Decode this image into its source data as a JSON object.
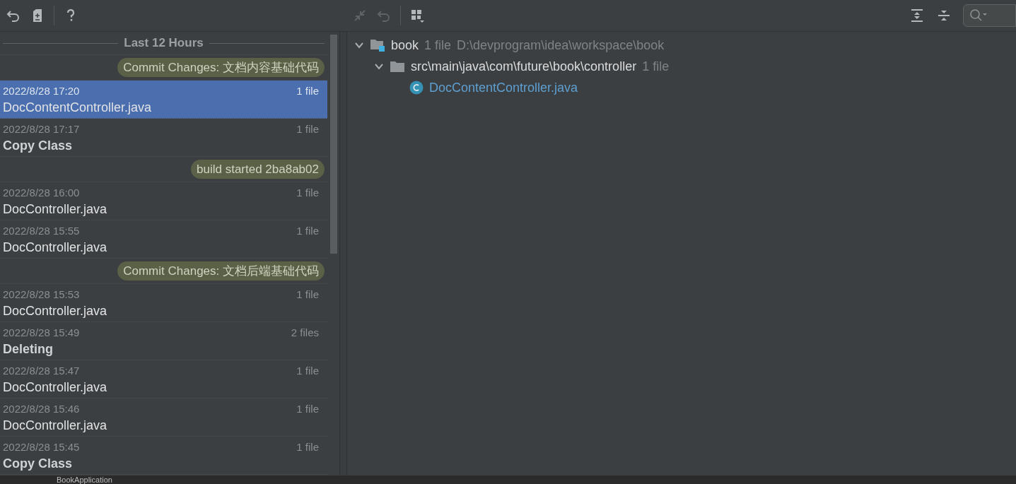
{
  "toolbar": {
    "left_tools": [
      {
        "kind": "undo",
        "disabled": false
      },
      {
        "kind": "diff",
        "disabled": false
      },
      {
        "kind": "help",
        "disabled": false
      }
    ],
    "middle_tools": [
      {
        "kind": "merge",
        "disabled": true
      },
      {
        "kind": "undo",
        "disabled": true
      },
      {
        "kind": "group",
        "disabled": false
      }
    ],
    "right_tools": [
      {
        "kind": "expand",
        "disabled": false
      },
      {
        "kind": "collapse",
        "disabled": false
      }
    ]
  },
  "history": [
    {
      "kind": "header",
      "text": "Last 12 Hours"
    },
    {
      "kind": "label",
      "text": "Commit Changes: 文档内容基础代码"
    },
    {
      "kind": "entry",
      "time": "2022/8/28 17:20",
      "files": "1 file",
      "title": "DocContentController.java",
      "bold": false,
      "selected": true
    },
    {
      "kind": "entry",
      "time": "2022/8/28 17:17",
      "files": "1 file",
      "title": "Copy Class",
      "bold": true,
      "selected": false
    },
    {
      "kind": "label",
      "text": "build started 2ba8ab02"
    },
    {
      "kind": "entry",
      "time": "2022/8/28 16:00",
      "files": "1 file",
      "title": "DocController.java",
      "bold": false,
      "selected": false
    },
    {
      "kind": "entry",
      "time": "2022/8/28 15:55",
      "files": "1 file",
      "title": "DocController.java",
      "bold": false,
      "selected": false
    },
    {
      "kind": "label",
      "text": "Commit Changes: 文档后端基础代码"
    },
    {
      "kind": "entry",
      "time": "2022/8/28 15:53",
      "files": "1 file",
      "title": "DocController.java",
      "bold": false,
      "selected": false
    },
    {
      "kind": "entry",
      "time": "2022/8/28 15:49",
      "files": "2 files",
      "title": "Deleting",
      "bold": true,
      "selected": false
    },
    {
      "kind": "entry",
      "time": "2022/8/28 15:47",
      "files": "1 file",
      "title": "DocController.java",
      "bold": false,
      "selected": false
    },
    {
      "kind": "entry",
      "time": "2022/8/28 15:46",
      "files": "1 file",
      "title": "DocController.java",
      "bold": false,
      "selected": false
    },
    {
      "kind": "entry",
      "time": "2022/8/28 15:45",
      "files": "1 file",
      "title": "Copy Class",
      "bold": true,
      "selected": false
    }
  ],
  "tree": [
    {
      "kind": "module",
      "name": "book",
      "count": "1 file",
      "path": "D:\\devprogram\\idea\\workspace\\book",
      "expanded": true,
      "children": [
        {
          "kind": "folder",
          "name": "src\\main\\java\\com\\future\\book\\controller",
          "count": "1 file",
          "expanded": true,
          "children": [
            {
              "kind": "class",
              "name": "DocContentController.java"
            }
          ]
        }
      ]
    }
  ],
  "bottom_strip": {
    "text": "BookApplication"
  }
}
